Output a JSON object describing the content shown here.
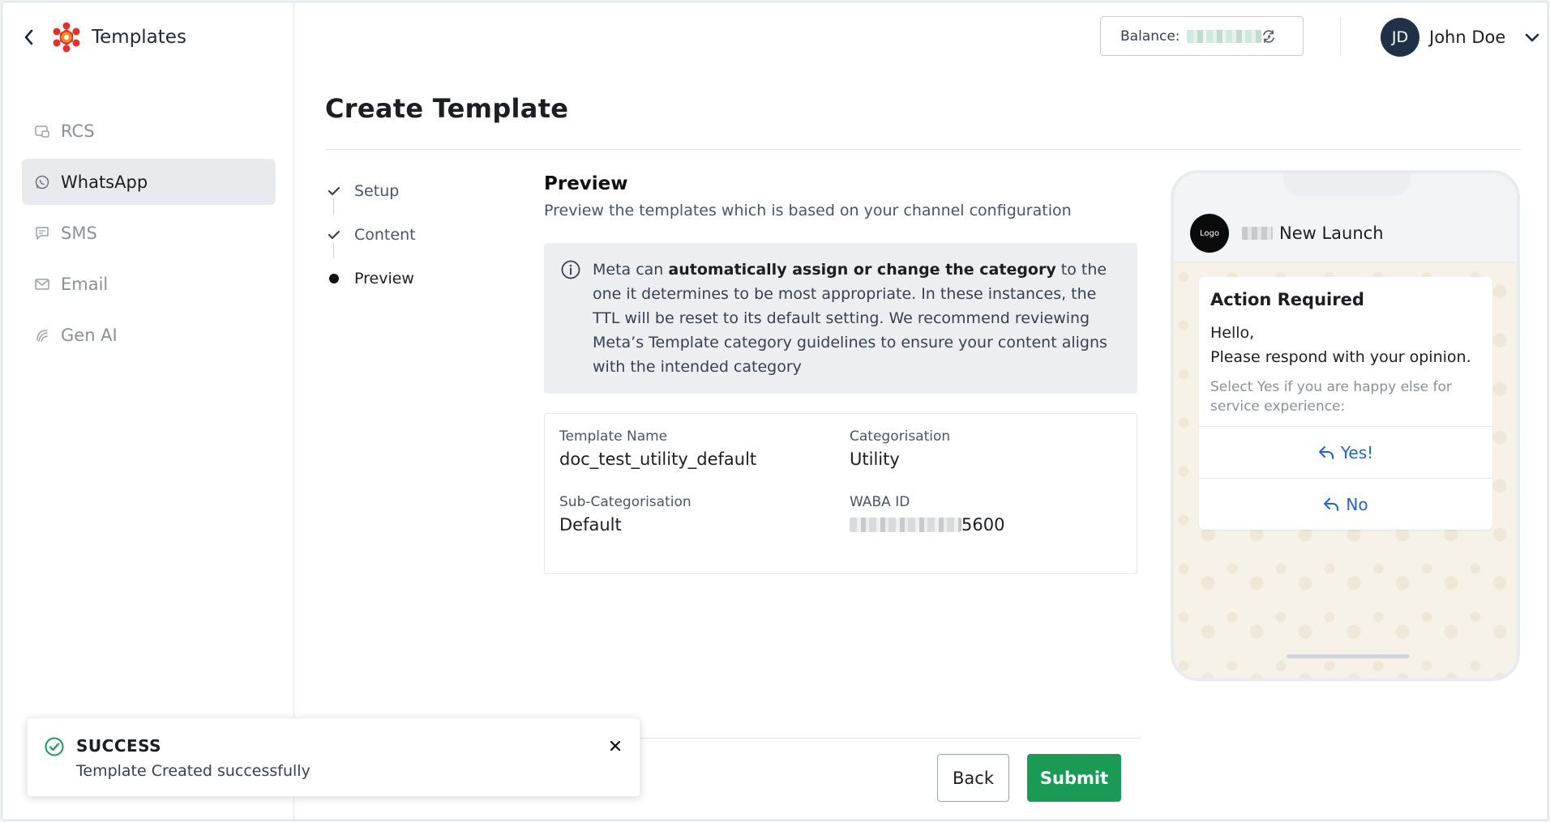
{
  "sidebar": {
    "title": "Templates",
    "items": [
      {
        "label": "RCS",
        "icon": "rcs-icon",
        "active": false
      },
      {
        "label": "WhatsApp",
        "icon": "whatsapp-icon",
        "active": true
      },
      {
        "label": "SMS",
        "icon": "sms-icon",
        "active": false
      },
      {
        "label": "Email",
        "icon": "email-icon",
        "active": false
      },
      {
        "label": "Gen AI",
        "icon": "gen-ai-icon",
        "active": false
      }
    ]
  },
  "header": {
    "balance_label": "Balance:",
    "user": {
      "initials": "JD",
      "name": "John Doe"
    }
  },
  "page": {
    "title": "Create Template"
  },
  "steps": [
    {
      "label": "Setup",
      "state": "done"
    },
    {
      "label": "Content",
      "state": "done"
    },
    {
      "label": "Preview",
      "state": "current"
    }
  ],
  "preview": {
    "title": "Preview",
    "subtitle": "Preview the templates which is based on your channel configuration",
    "info": {
      "pre": "Meta can ",
      "bold": "automatically assign or change the category",
      "post": " to the one it determines to be most appropriate. In these instances, the TTL will be reset to its default setting. We recommend reviewing Meta’s Template category guidelines to ensure your content aligns with the intended category"
    },
    "details": {
      "template_name_label": "Template Name",
      "template_name": "doc_test_utility_default",
      "categorisation_label": "Categorisation",
      "categorisation": "Utility",
      "sub_categorisation_label": "Sub-Categorisation",
      "sub_categorisation": "Default",
      "waba_id_label": "WABA ID",
      "waba_id_suffix": "5600"
    }
  },
  "actions": {
    "back": "Back",
    "submit": "Submit"
  },
  "phone": {
    "logo_text": "Logo",
    "sender_name": "New Launch",
    "message": {
      "header": "Action Required",
      "body_line1": "Hello,",
      "body_line2": "Please respond with your opinion.",
      "footer": "Select Yes if you are happy else for service experience:",
      "buttons": [
        "Yes!",
        "No"
      ]
    }
  },
  "toast": {
    "title": "SUCCESS",
    "message": "Template Created successfully"
  },
  "colors": {
    "accent_green": "#1a9a55",
    "link_blue": "#2563c9",
    "avatar_bg": "#1f3147",
    "logo_red": "#e0322d",
    "logo_orange": "#f28c28"
  }
}
